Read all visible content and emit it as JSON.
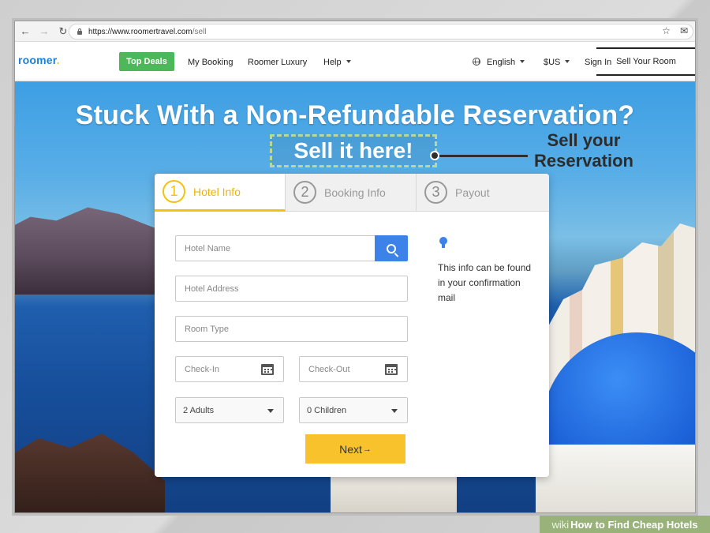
{
  "browser": {
    "url_host": "https://www.roomertravel.com",
    "url_path": "/sell"
  },
  "header": {
    "logo_text": "roomer",
    "logo_dot": ".",
    "top_deals": "Top Deals",
    "my_booking": "My Booking",
    "roomer_luxury": "Roomer Luxury",
    "help": "Help",
    "language": "English",
    "currency": "$US",
    "sign_in": "Sign In",
    "sell_your_room": "Sell Your Room"
  },
  "hero": {
    "title": "Stuck With a Non-Refundable Reservation?",
    "subtitle": "Sell it here!",
    "callout_line1": "Sell your",
    "callout_line2": "Reservation"
  },
  "form": {
    "tabs": [
      {
        "num": "1",
        "label": "Hotel Info"
      },
      {
        "num": "2",
        "label": "Booking Info"
      },
      {
        "num": "3",
        "label": "Payout"
      }
    ],
    "hotel_name_placeholder": "Hotel Name",
    "hotel_address_placeholder": "Hotel Address",
    "room_type_placeholder": "Room Type",
    "check_in_placeholder": "Check-In",
    "check_out_placeholder": "Check-Out",
    "adults_value": "2 Adults",
    "children_value": "0 Children",
    "next_label": "Next",
    "next_arrow": "→",
    "info_text": "This info can be found in your confirmation mail"
  },
  "watermark": {
    "brand": "wiki",
    "how": "How",
    "rest": "to Find Cheap Hotels"
  },
  "colors": {
    "accent_yellow": "#f4c10e",
    "button_green": "#4cb85a",
    "search_blue": "#3c82e9",
    "logo_blue": "#1d7fd6"
  }
}
